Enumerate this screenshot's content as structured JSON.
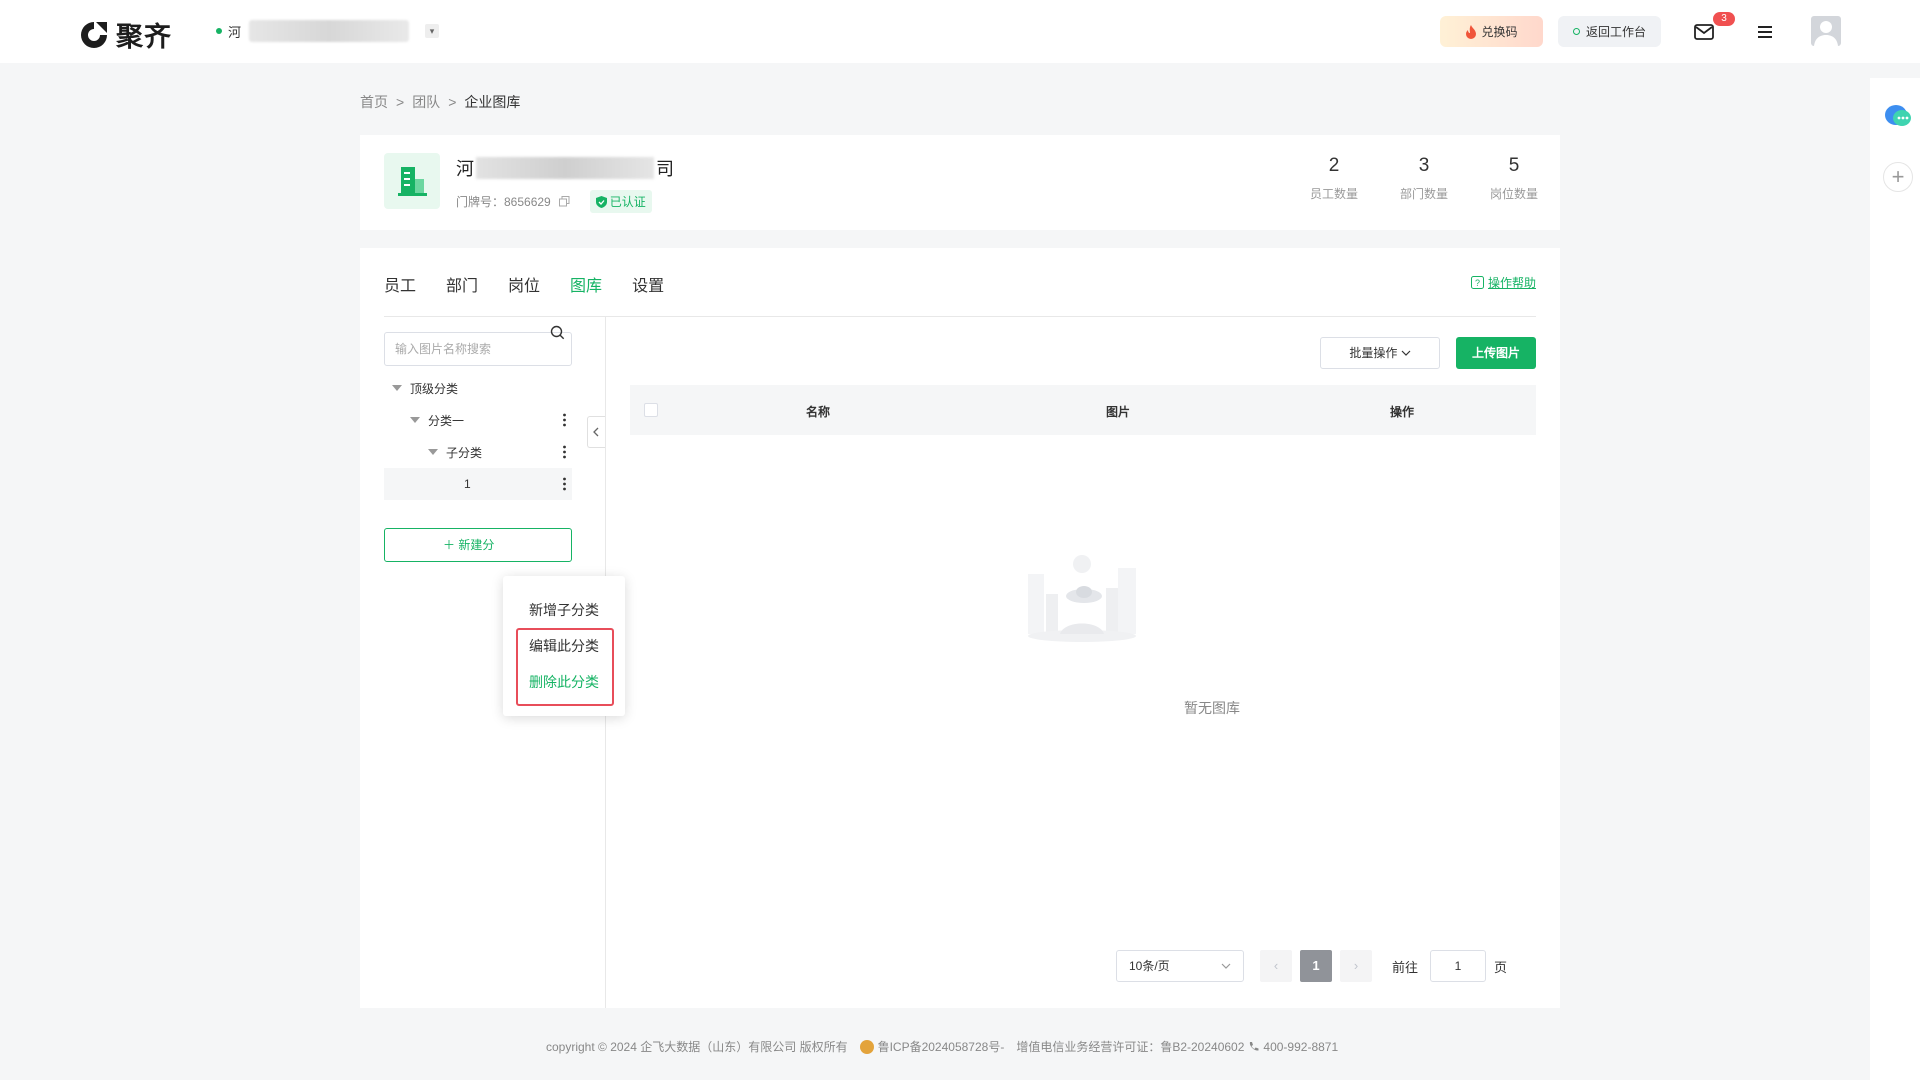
{
  "header": {
    "brand": "聚齐",
    "org_prefix": "河",
    "redeem_label": "兑换码",
    "back_label": "返回工作台",
    "mail_badge": "3",
    "colors": {
      "accent": "#16b364",
      "badge": "#f05050"
    }
  },
  "breadcrumb": {
    "home": "首页",
    "team": "团队",
    "current": "企业图库",
    "separator": ">"
  },
  "company": {
    "name_prefix": "河",
    "name_suffix": "司",
    "door_label": "门牌号：8656629",
    "verified": "已认证",
    "stats": [
      {
        "value": "2",
        "label": "员工数量"
      },
      {
        "value": "3",
        "label": "部门数量"
      },
      {
        "value": "5",
        "label": "岗位数量"
      }
    ]
  },
  "tabs": [
    {
      "label": "员工"
    },
    {
      "label": "部门"
    },
    {
      "label": "岗位"
    },
    {
      "label": "图库",
      "active": true
    },
    {
      "label": "设置"
    }
  ],
  "help_label": "操作帮助",
  "search": {
    "placeholder": "输入图片名称搜索"
  },
  "tree": {
    "root": "顶级分类",
    "level1": "分类一",
    "level2": "子分类",
    "level3": "1"
  },
  "new_category_label": "新建分",
  "context_menu": {
    "add_child": "新增子分类",
    "edit": "编辑此分类",
    "delete": "删除此分类"
  },
  "toolbar": {
    "batch_label": "批量操作",
    "upload_label": "上传图片"
  },
  "table": {
    "columns": [
      "名称",
      "图片",
      "操作"
    ],
    "empty": "暂无图库"
  },
  "pagination": {
    "page_size": "10条/页",
    "current_page": "1",
    "goto_label": "前往",
    "goto_value": "1",
    "page_unit": "页",
    "prev": "‹",
    "next": "›"
  },
  "footer": {
    "copyright": "copyright © 2024 企飞大数据（山东）有限公司 版权所有",
    "icp": "鲁ICP备2024058728号-",
    "license": "增值电信业务经营许可证：鲁B2-20240602",
    "phone": "400-992-8871"
  }
}
